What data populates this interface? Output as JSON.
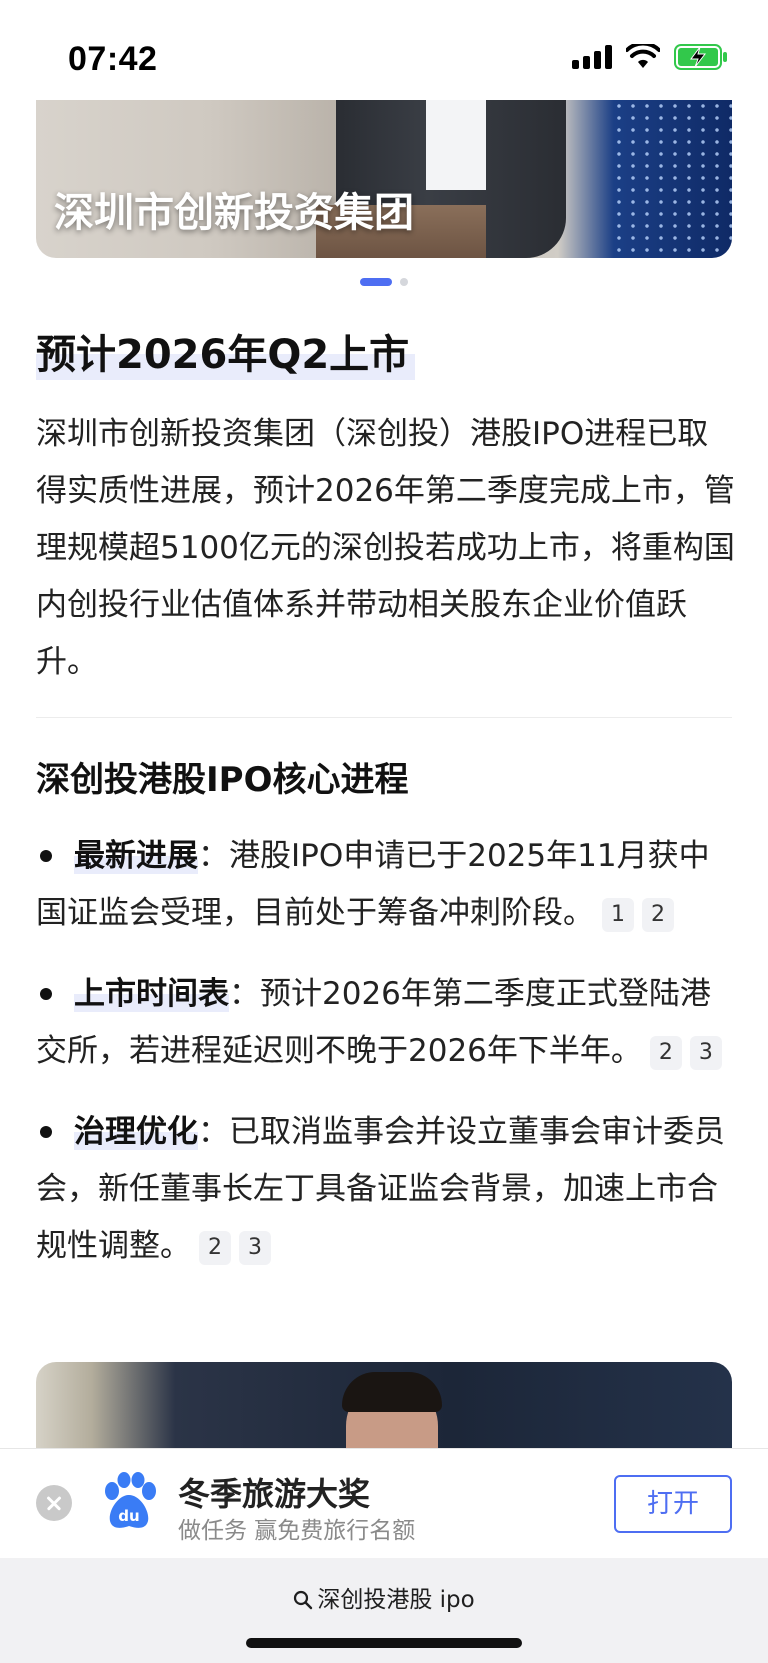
{
  "status_bar": {
    "time": "07:42",
    "icons": [
      "signal-icon",
      "wifi-icon",
      "battery-charging-icon"
    ],
    "battery_color": "#32c84b"
  },
  "hero": {
    "caption": "深圳市创新投资集团",
    "pager": {
      "count": 2,
      "active_index": 0
    }
  },
  "article": {
    "headline": "预计2026年Q2上市",
    "summary": "深圳市创新投资集团（深创投）港股IPO进程已取得实质性进展，预计2026年第二季度完成上市，管理规模超5100亿元的深创投若成功上市，将重构国内创投行业估值体系并带动相关股东企业价值跃升。",
    "section_title": "深创投港股IPO核心进程",
    "bullets": [
      {
        "label": "最新进展",
        "text": "：港股IPO申请已于2025年11月获中国证监会受理，目前处于筹备冲刺阶段。",
        "citations": [
          "1",
          "2"
        ]
      },
      {
        "label": "上市时间表",
        "text": "：预计2026年第二季度正式登陆港交所，若进程延迟则不晚于2026年下半年。",
        "citations": [
          "2",
          "3"
        ]
      },
      {
        "label": "治理优化",
        "text": "：已取消监事会并设立董事会审计委员会，新任董事长左丁具备证监会背景，加速上市合规性调整。",
        "citations": [
          "2",
          "3"
        ]
      }
    ]
  },
  "app_banner": {
    "title": "冬季旅游大奖",
    "subtitle": "做任务 赢免费旅行名额",
    "open_label": "打开",
    "accent": "#4e6ef2"
  },
  "url_bar": {
    "text": "深创投港股 ipo"
  }
}
